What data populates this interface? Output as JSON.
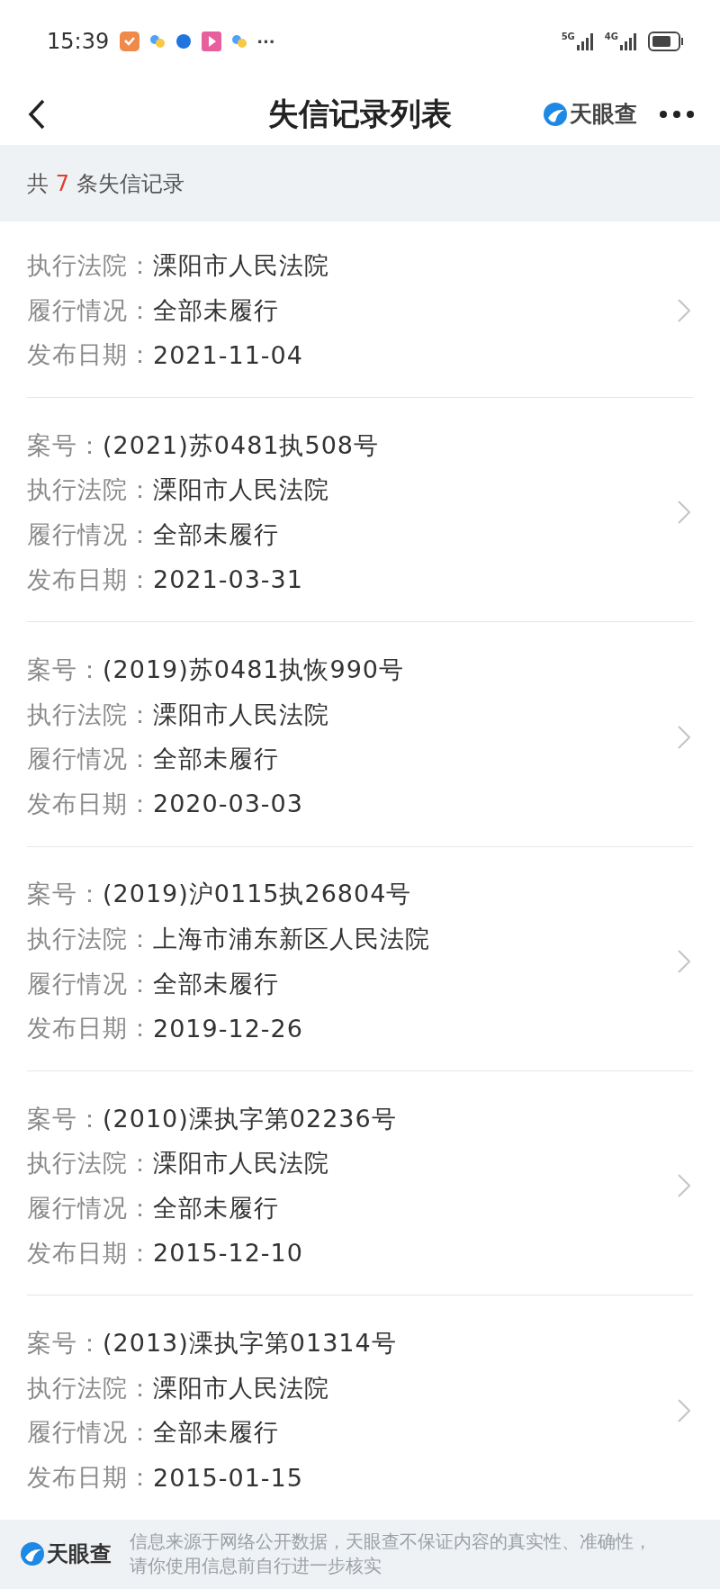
{
  "status_bar": {
    "time": "15:39",
    "more": "···",
    "network_1": "5G",
    "network_2": "4G"
  },
  "header": {
    "title": "失信记录列表",
    "brand": "天眼查"
  },
  "summary": {
    "prefix": "共",
    "count": "7",
    "suffix": "条失信记录"
  },
  "records": [
    {
      "fields": [
        {
          "label": "执行法院：",
          "value": "溧阳市人民法院"
        },
        {
          "label": "履行情况：",
          "value": "全部未履行"
        },
        {
          "label": "发布日期：",
          "value": "2021-11-04"
        }
      ]
    },
    {
      "fields": [
        {
          "label": "案号：",
          "value": "(2021)苏0481执508号"
        },
        {
          "label": "执行法院：",
          "value": "溧阳市人民法院"
        },
        {
          "label": "履行情况：",
          "value": "全部未履行"
        },
        {
          "label": "发布日期：",
          "value": "2021-03-31"
        }
      ]
    },
    {
      "fields": [
        {
          "label": "案号：",
          "value": "(2019)苏0481执恢990号"
        },
        {
          "label": "执行法院：",
          "value": "溧阳市人民法院"
        },
        {
          "label": "履行情况：",
          "value": "全部未履行"
        },
        {
          "label": "发布日期：",
          "value": "2020-03-03"
        }
      ]
    },
    {
      "fields": [
        {
          "label": "案号：",
          "value": "(2019)沪0115执26804号"
        },
        {
          "label": "执行法院：",
          "value": "上海市浦东新区人民法院"
        },
        {
          "label": "履行情况：",
          "value": "全部未履行"
        },
        {
          "label": "发布日期：",
          "value": "2019-12-26"
        }
      ]
    },
    {
      "fields": [
        {
          "label": "案号：",
          "value": "(2010)溧执字第02236号"
        },
        {
          "label": "执行法院：",
          "value": "溧阳市人民法院"
        },
        {
          "label": "履行情况：",
          "value": "全部未履行"
        },
        {
          "label": "发布日期：",
          "value": "2015-12-10"
        }
      ]
    },
    {
      "fields": [
        {
          "label": "案号：",
          "value": "(2013)溧执字第01314号"
        },
        {
          "label": "执行法院：",
          "value": "溧阳市人民法院"
        },
        {
          "label": "履行情况：",
          "value": "全部未履行"
        },
        {
          "label": "发布日期：",
          "value": "2015-01-15"
        }
      ]
    }
  ],
  "footer": {
    "brand": "天眼查",
    "notice": "信息来源于网络公开数据，天眼查不保证内容的真实性、准确性，请你使用信息前自行进一步核实"
  }
}
